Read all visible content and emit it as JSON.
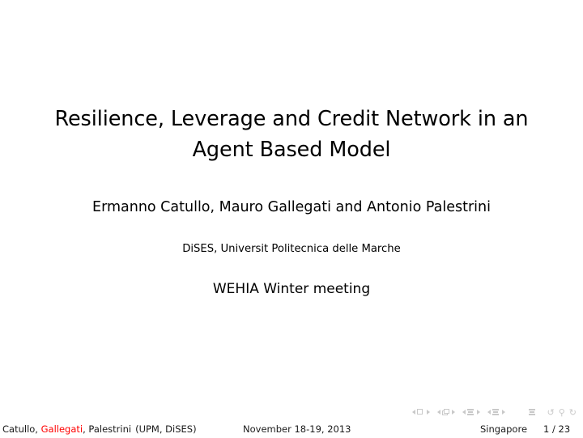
{
  "slide": {
    "title": "Resilience, Leverage and Credit Network in an Agent Based Model",
    "authors": "Ermanno Catullo, Mauro Gallegati and Antonio Palestrini",
    "institute": "DiSES, Universit Politecnica delle Marche",
    "event": "WEHIA Winter meeting"
  },
  "footer": {
    "authors_short_before": "Catullo, ",
    "authors_short_highlight": "Gallegati",
    "authors_short_after": ", Palestrini",
    "institute_short": "(UPM, DiSES)",
    "date": "November 18-19, 2013",
    "location": "Singapore",
    "page": "1 / 23",
    "highlight_color": "#ff0000"
  },
  "navigation_symbols": {
    "color": "#c9c9c9",
    "items": [
      {
        "name": "slide-navigation",
        "icon": "square-icon"
      },
      {
        "name": "frame-navigation",
        "icon": "stacked-squares-icon"
      },
      {
        "name": "subsection-navigation",
        "icon": "stacked-bars-icon"
      },
      {
        "name": "section-navigation",
        "icon": "stacked-bars-icon"
      },
      {
        "name": "presentation-navigation",
        "icon": "stacked-bars-icon"
      }
    ],
    "back_glyph": "↺",
    "search_glyph": "⚲",
    "forward_glyph": "↻"
  }
}
